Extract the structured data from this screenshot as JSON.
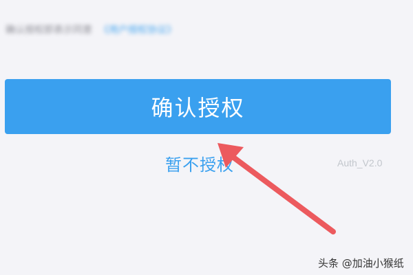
{
  "agreement": {
    "text": "确认授权即表示同意",
    "link_label": "《用户授权协议》"
  },
  "confirm_button": {
    "label": "确认授权"
  },
  "deny_link": {
    "label": "暂不授权"
  },
  "version": {
    "label": "Auth_V2.0"
  },
  "annotation": {
    "arrow_color": "#ec5a5e"
  },
  "watermark": {
    "text": "头条 @加油小猴纸"
  },
  "colors": {
    "accent": "#3aa0ef",
    "background": "#f4f4f8"
  }
}
